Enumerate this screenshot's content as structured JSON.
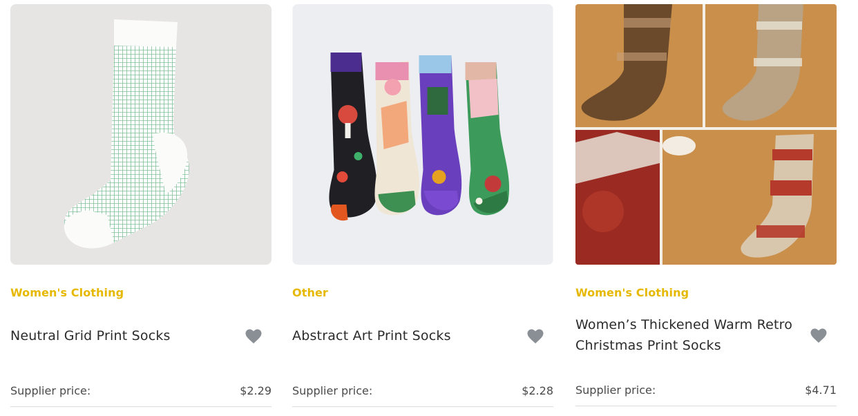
{
  "products": [
    {
      "category": "Women's Clothing",
      "title": "Neutral Grid Print Socks",
      "price_label": "Supplier price:",
      "price": "$2.29",
      "image_icon": "grid-sock-image"
    },
    {
      "category": "Other",
      "title": "Abstract Art Print Socks",
      "price_label": "Supplier price:",
      "price": "$2.28",
      "image_icon": "art-socks-image"
    },
    {
      "category": "Women's Clothing",
      "title": "Women’s Thickened Warm Retro Christmas Print Socks",
      "price_label": "Supplier price:",
      "price": "$4.71",
      "image_icon": "christmas-socks-image"
    }
  ],
  "colors": {
    "category": "#e6b800",
    "heart": "#8a8f96",
    "divider": "#dcdcdc"
  },
  "icons": {
    "favorite": "heart-icon"
  }
}
